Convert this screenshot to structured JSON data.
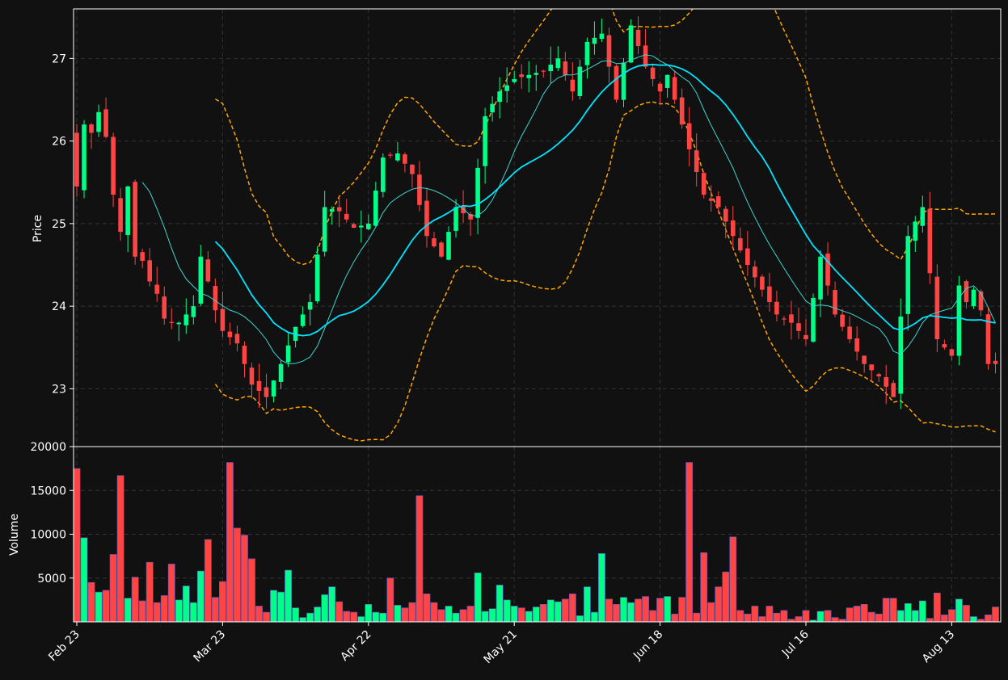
{
  "chart_data": {
    "type": "candlestick",
    "x_ticks": [
      "Feb 23",
      "Mar 23",
      "Apr 22",
      "May 21",
      "Jun 18",
      "Jul 16",
      "Aug 13"
    ],
    "x_tick_index": [
      0,
      20,
      40,
      60,
      80,
      100,
      120
    ],
    "n_bars": 127,
    "price_axis": {
      "label": "Price",
      "ylim": [
        22.3,
        27.6
      ],
      "ticks": [
        23,
        24,
        25,
        26,
        27
      ]
    },
    "volume_axis": {
      "label": "Volume",
      "ylim": [
        0,
        20000
      ],
      "ticks": [
        5000,
        10000,
        15000,
        20000
      ]
    },
    "grid": true,
    "colors": {
      "up": "#00ff88",
      "down": "#ff4444",
      "ma_fast": "#3cd6cf",
      "ma_slow": "#00e5ff",
      "bands": "#ffa500",
      "background": "#111111",
      "grid": "#333333",
      "axis": "#ffffff"
    },
    "anchors": {
      "close": [
        [
          0,
          25.45
        ],
        [
          1,
          26.2
        ],
        [
          2,
          26.1
        ],
        [
          3,
          26.35
        ],
        [
          4,
          26.05
        ],
        [
          5,
          25.35
        ],
        [
          6,
          24.9
        ],
        [
          7,
          25.45
        ],
        [
          8,
          24.6
        ],
        [
          9,
          24.55
        ],
        [
          10,
          24.3
        ],
        [
          11,
          24.15
        ],
        [
          12,
          23.85
        ],
        [
          13,
          23.8
        ],
        [
          14,
          23.8
        ],
        [
          15,
          23.9
        ],
        [
          16,
          24.0
        ],
        [
          17,
          24.6
        ],
        [
          18,
          24.3
        ],
        [
          19,
          23.95
        ],
        [
          20,
          23.7
        ],
        [
          22,
          23.55
        ],
        [
          24,
          23.05
        ],
        [
          26,
          22.9
        ],
        [
          28,
          23.3
        ],
        [
          30,
          23.75
        ],
        [
          32,
          24.05
        ],
        [
          34,
          25.2
        ],
        [
          36,
          25.15
        ],
        [
          38,
          24.95
        ],
        [
          40,
          25.0
        ],
        [
          41,
          25.4
        ],
        [
          42,
          25.8
        ],
        [
          44,
          25.85
        ],
        [
          46,
          25.6
        ],
        [
          48,
          24.85
        ],
        [
          50,
          24.6
        ],
        [
          52,
          25.2
        ],
        [
          54,
          25.05
        ],
        [
          56,
          26.3
        ],
        [
          58,
          26.6
        ],
        [
          60,
          26.75
        ],
        [
          62,
          26.8
        ],
        [
          64,
          26.85
        ],
        [
          66,
          27.0
        ],
        [
          68,
          26.6
        ],
        [
          70,
          27.2
        ],
        [
          72,
          27.3
        ],
        [
          74,
          26.5
        ],
        [
          76,
          27.4
        ],
        [
          78,
          26.9
        ],
        [
          80,
          26.6
        ],
        [
          81,
          26.8
        ],
        [
          82,
          26.5
        ],
        [
          84,
          25.9
        ],
        [
          86,
          25.35
        ],
        [
          88,
          25.2
        ],
        [
          90,
          24.85
        ],
        [
          92,
          24.5
        ],
        [
          94,
          24.2
        ],
        [
          96,
          23.9
        ],
        [
          98,
          23.8
        ],
        [
          100,
          23.6
        ],
        [
          102,
          24.6
        ],
        [
          104,
          23.9
        ],
        [
          106,
          23.6
        ],
        [
          108,
          23.3
        ],
        [
          110,
          23.15
        ],
        [
          112,
          22.9
        ],
        [
          114,
          24.85
        ],
        [
          116,
          25.2
        ],
        [
          118,
          23.6
        ],
        [
          120,
          23.4
        ],
        [
          121,
          24.25
        ],
        [
          122,
          24.05
        ],
        [
          123,
          24.2
        ],
        [
          124,
          23.95
        ],
        [
          125,
          23.3
        ]
      ],
      "volume": [
        [
          0,
          17500
        ],
        [
          1,
          9600
        ],
        [
          2,
          4500
        ],
        [
          3,
          3400
        ],
        [
          4,
          3600
        ],
        [
          5,
          7700
        ],
        [
          6,
          16700
        ],
        [
          7,
          2700
        ],
        [
          8,
          5100
        ],
        [
          9,
          2400
        ],
        [
          10,
          6800
        ],
        [
          11,
          2200
        ],
        [
          12,
          3000
        ],
        [
          13,
          6600
        ],
        [
          14,
          2500
        ],
        [
          15,
          4100
        ],
        [
          16,
          2200
        ],
        [
          17,
          5800
        ],
        [
          18,
          9400
        ],
        [
          19,
          2800
        ],
        [
          20,
          4600
        ],
        [
          21,
          18200
        ],
        [
          22,
          10700
        ],
        [
          23,
          9900
        ],
        [
          24,
          7200
        ],
        [
          25,
          1800
        ],
        [
          26,
          1100
        ],
        [
          27,
          3600
        ],
        [
          28,
          3400
        ],
        [
          29,
          5900
        ],
        [
          30,
          1600
        ],
        [
          31,
          500
        ],
        [
          32,
          1000
        ],
        [
          33,
          1700
        ],
        [
          34,
          3100
        ],
        [
          35,
          4000
        ],
        [
          36,
          2300
        ],
        [
          37,
          1200
        ],
        [
          38,
          1100
        ],
        [
          39,
          600
        ],
        [
          40,
          2000
        ],
        [
          41,
          1100
        ],
        [
          42,
          1000
        ],
        [
          43,
          5000
        ],
        [
          44,
          1900
        ],
        [
          45,
          1600
        ],
        [
          46,
          2200
        ],
        [
          47,
          14400
        ],
        [
          48,
          3200
        ],
        [
          49,
          2200
        ],
        [
          50,
          1400
        ],
        [
          51,
          1800
        ],
        [
          52,
          1000
        ],
        [
          53,
          1400
        ],
        [
          54,
          1800
        ],
        [
          55,
          5600
        ],
        [
          56,
          1200
        ],
        [
          57,
          1500
        ],
        [
          58,
          4200
        ],
        [
          59,
          2500
        ],
        [
          60,
          1800
        ],
        [
          61,
          1600
        ],
        [
          62,
          1200
        ],
        [
          63,
          1700
        ],
        [
          64,
          2000
        ],
        [
          65,
          2500
        ],
        [
          66,
          2300
        ],
        [
          67,
          2600
        ],
        [
          68,
          3200
        ],
        [
          69,
          700
        ],
        [
          70,
          4000
        ],
        [
          71,
          1100
        ],
        [
          72,
          7800
        ],
        [
          73,
          2600
        ],
        [
          74,
          2000
        ],
        [
          75,
          2800
        ],
        [
          76,
          2200
        ],
        [
          77,
          2600
        ],
        [
          78,
          2900
        ],
        [
          79,
          1300
        ],
        [
          80,
          2700
        ],
        [
          81,
          2900
        ],
        [
          82,
          900
        ],
        [
          83,
          2800
        ],
        [
          84,
          18200
        ],
        [
          85,
          1000
        ],
        [
          86,
          7900
        ],
        [
          87,
          2200
        ],
        [
          88,
          4000
        ],
        [
          89,
          5700
        ],
        [
          90,
          9700
        ],
        [
          91,
          1300
        ],
        [
          92,
          900
        ],
        [
          93,
          1800
        ],
        [
          94,
          600
        ],
        [
          95,
          1800
        ],
        [
          96,
          1000
        ],
        [
          97,
          1300
        ],
        [
          98,
          300
        ],
        [
          99,
          600
        ],
        [
          100,
          1300
        ],
        [
          101,
          200
        ],
        [
          102,
          1200
        ],
        [
          103,
          1300
        ],
        [
          104,
          500
        ],
        [
          105,
          300
        ],
        [
          106,
          1600
        ],
        [
          107,
          1800
        ],
        [
          108,
          2000
        ],
        [
          109,
          1100
        ],
        [
          110,
          900
        ],
        [
          111,
          2700
        ],
        [
          112,
          2700
        ],
        [
          113,
          1300
        ],
        [
          114,
          2100
        ],
        [
          115,
          1300
        ],
        [
          116,
          2400
        ],
        [
          117,
          400
        ],
        [
          118,
          3300
        ],
        [
          119,
          800
        ],
        [
          120,
          1400
        ],
        [
          121,
          2600
        ],
        [
          122,
          1900
        ],
        [
          123,
          600
        ],
        [
          124,
          300
        ],
        [
          125,
          800
        ],
        [
          126,
          1700
        ]
      ]
    }
  }
}
